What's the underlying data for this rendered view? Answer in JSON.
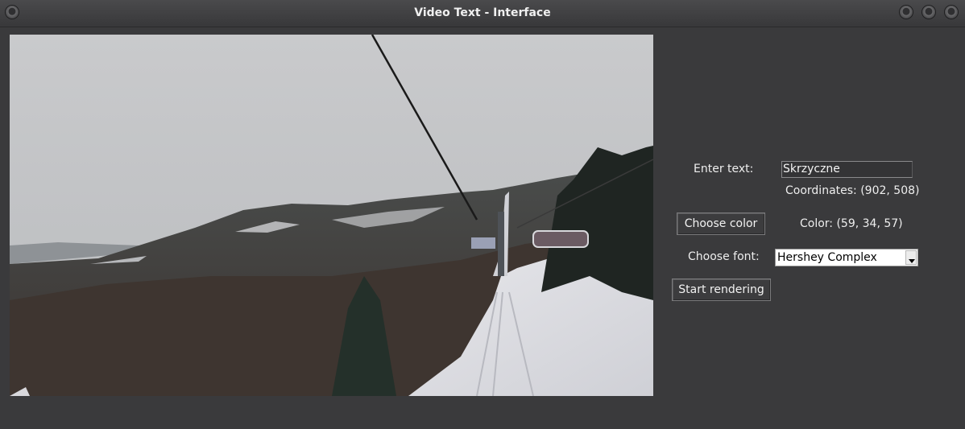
{
  "window": {
    "title": "Video Text - Interface"
  },
  "video_frame": {
    "description_icon": "video-frame-image"
  },
  "controls": {
    "enter_text_label": "Enter text:",
    "text_value": "Skrzyczne",
    "coordinates_text": "Coordinates: (902, 508)",
    "choose_color_label": "Choose color",
    "color_text": "Color: (59, 34, 57)",
    "choose_font_label": "Choose font:",
    "font_value": "Hershey Complex",
    "start_rendering_label": "Start rendering"
  },
  "colors": {
    "background": "#3a3a3c",
    "text": "#eeeeee"
  }
}
